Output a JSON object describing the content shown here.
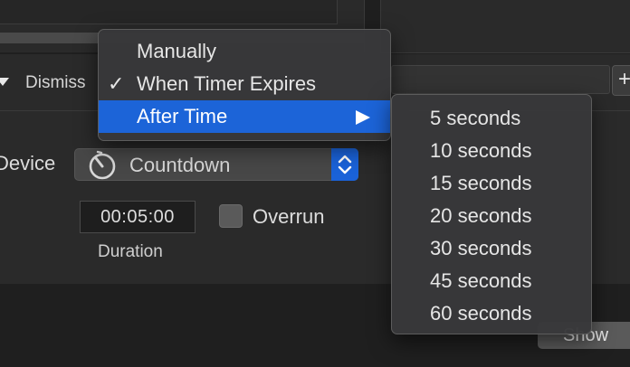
{
  "dismiss": {
    "label": "Dismiss"
  },
  "device": {
    "label": "Device"
  },
  "popup": {
    "selected": "Countdown"
  },
  "duration": {
    "value": "00:05:00",
    "label": "Duration"
  },
  "overrun": {
    "label": "Overrun",
    "checked": false
  },
  "add_button": {
    "label": "+"
  },
  "show_button": {
    "label": "Show"
  },
  "dismiss_menu": {
    "items": [
      {
        "label": "Manually",
        "checked": false
      },
      {
        "label": "When Timer Expires",
        "checked": true,
        "check_mark": "✓"
      },
      {
        "label": "After Time",
        "highlighted": true,
        "has_submenu": true
      }
    ]
  },
  "after_time_submenu": {
    "items": [
      "5 seconds",
      "10 seconds",
      "15 seconds",
      "20 seconds",
      "30 seconds",
      "45 seconds",
      "60 seconds"
    ]
  },
  "colors": {
    "accent": "#1c64d8",
    "menu_bg": "#38383a",
    "window_bg": "#2a2a2a"
  },
  "icons": [
    "timer-icon",
    "checkmark-icon",
    "submenu-arrow-icon",
    "stepper-icon",
    "disclosure-triangle-icon",
    "add-icon"
  ]
}
